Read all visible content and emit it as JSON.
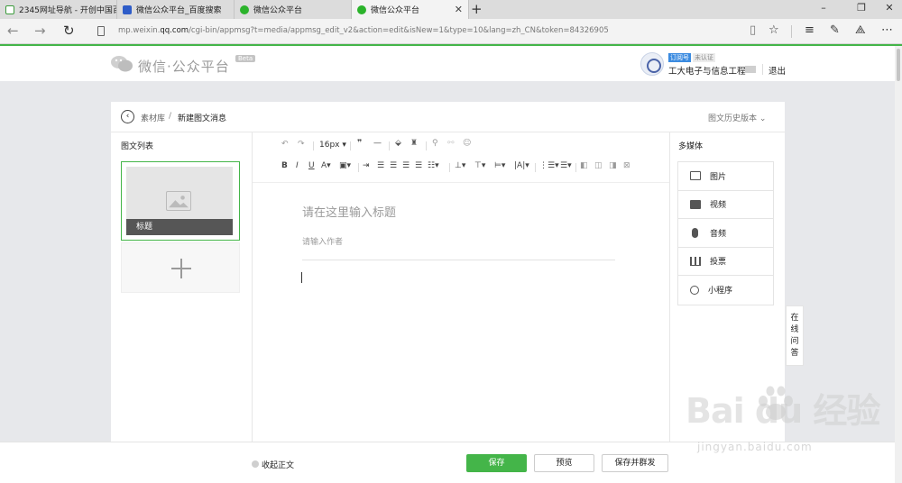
{
  "browser": {
    "tabs": [
      {
        "label": "2345网址导航 - 开创中国百",
        "favicon": "2345-icon"
      },
      {
        "label": "微信公众平台_百度搜索",
        "favicon": "baidu-paw-icon"
      },
      {
        "label": "微信公众平台",
        "favicon": "wechat-icon"
      },
      {
        "label": "微信公众平台",
        "favicon": "wechat-icon"
      }
    ],
    "active_tab_index": 3,
    "close_glyph": "✕",
    "new_tab_glyph": "+",
    "url_prefix": "mp.weixin.",
    "url_domain": "qq.com",
    "url_rest": "/cgi-bin/appmsg?t=media/appmsg_edit_v2&action=edit&isNew=1&type=10&lang=zh_CN&token=84326905"
  },
  "header": {
    "logo_text": "微信·公众平台",
    "beta": "Beta",
    "account_badge_type": "订阅号",
    "account_badge_status": "未认证",
    "account_name": "工大电子与信息工程",
    "logout": "退出"
  },
  "breadcrumb": {
    "library": "素材库",
    "separator": "/",
    "current": "新建图文消息",
    "history": "图文历史版本"
  },
  "left_panel": {
    "title": "图文列表",
    "article_label": "标题"
  },
  "toolbar": {
    "font_size": "16px"
  },
  "editor": {
    "title_placeholder": "请在这里输入标题",
    "author_placeholder": "请输入作者"
  },
  "media_panel": {
    "title": "多媒体",
    "items": [
      {
        "label": "图片",
        "icon": "image-icon"
      },
      {
        "label": "视频",
        "icon": "video-icon"
      },
      {
        "label": "音频",
        "icon": "microphone-icon"
      },
      {
        "label": "投票",
        "icon": "vote-icon"
      },
      {
        "label": "小程序",
        "icon": "mini-program-icon"
      }
    ]
  },
  "online_qa": [
    "在",
    "线",
    "问",
    "答"
  ],
  "footer": {
    "collapse": "收起正文",
    "save": "保存",
    "preview": "预览",
    "save_publish": "保存并群发"
  },
  "watermark": {
    "brand": "Bai du 经验",
    "url": "jingyan.baidu.com"
  },
  "colors": {
    "accent_green": "#44b549",
    "page_bg": "#e7e8eb"
  }
}
